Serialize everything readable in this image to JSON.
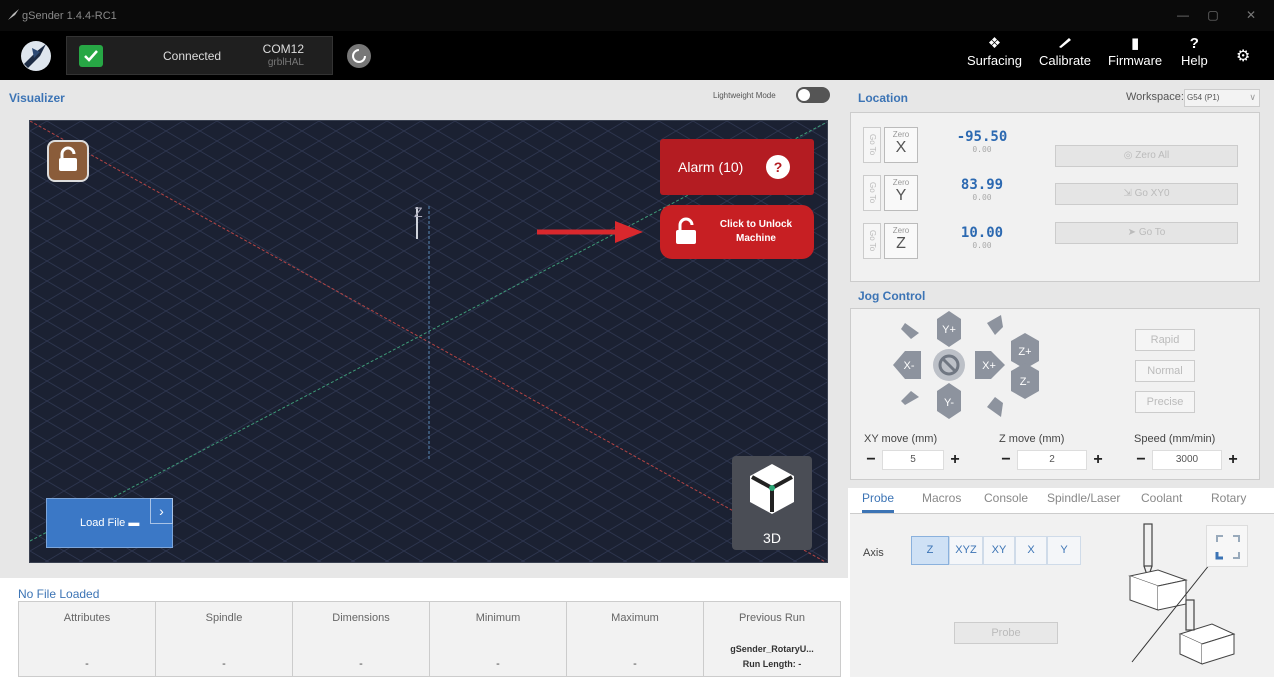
{
  "window": {
    "title": "gSender 1.4.4-RC1",
    "minimize": "—",
    "maximize": "▢",
    "close": "✕"
  },
  "connection": {
    "status": "Connected",
    "port": "COM12",
    "firmware": "grblHAL"
  },
  "nav": {
    "surfacing": "Surfacing",
    "calibrate": "Calibrate",
    "firmware": "Firmware",
    "help": "Help",
    "help_icon": "?",
    "surfacing_icon": "❖",
    "firmware_icon": "▮"
  },
  "visualizer": {
    "title": "Visualizer",
    "lightweight_label": "Lightweight Mode",
    "alarm_label": "Alarm (10)",
    "alarm_help": "?",
    "unlock_line1": "Click to Unlock",
    "unlock_line2": "Machine",
    "load_file": "Load File",
    "load_chevron": "›",
    "view_label": "3D",
    "z_axis_label": "Z"
  },
  "file_info": {
    "status": "No File Loaded",
    "columns": [
      {
        "header": "Attributes",
        "value": "-"
      },
      {
        "header": "Spindle",
        "value": "-"
      },
      {
        "header": "Dimensions",
        "value": "-"
      },
      {
        "header": "Minimum",
        "value": "-"
      },
      {
        "header": "Maximum",
        "value": "-"
      },
      {
        "header": "Previous Run",
        "line1": "gSender_RotaryU...",
        "line2": "Run Length: -"
      }
    ]
  },
  "location": {
    "title": "Location",
    "workspace_label": "Workspace:",
    "workspace_value": "G54 (P1)",
    "zero_label": "Zero",
    "goto_label": "Go To",
    "axes": [
      {
        "axis": "X",
        "value": "-95.50",
        "machine": "0.00"
      },
      {
        "axis": "Y",
        "value": "83.99",
        "machine": "0.00"
      },
      {
        "axis": "Z",
        "value": "10.00",
        "machine": "0.00"
      }
    ],
    "zero_all": "◎ Zero All",
    "go_xy0": "⇲ Go XY0",
    "go_to": "➤ Go To"
  },
  "jog": {
    "title": "Jog Control",
    "labels": {
      "yplus": "Y+",
      "yminus": "Y-",
      "xplus": "X+",
      "xminus": "X-",
      "zplus": "Z+",
      "zminus": "Z-"
    },
    "rapid": "Rapid",
    "normal": "Normal",
    "precise": "Precise",
    "xy_label": "XY move (mm)",
    "xy_value": "5",
    "z_label": "Z move (mm)",
    "z_value": "2",
    "speed_label": "Speed (mm/min)",
    "speed_value": "3000",
    "minus": "−",
    "plus": "+"
  },
  "tabs": [
    "Probe",
    "Macros",
    "Console",
    "Spindle/Laser",
    "Coolant",
    "Rotary"
  ],
  "probe": {
    "axis_label": "Axis",
    "axes": [
      "Z",
      "XYZ",
      "XY",
      "X",
      "Y"
    ],
    "selected": "Z",
    "probe_button": "Probe"
  },
  "colors": {
    "accent": "#3c74b5",
    "alarm": "#b41c22",
    "connected": "#27a745",
    "viz_bg": "#1b2132"
  }
}
